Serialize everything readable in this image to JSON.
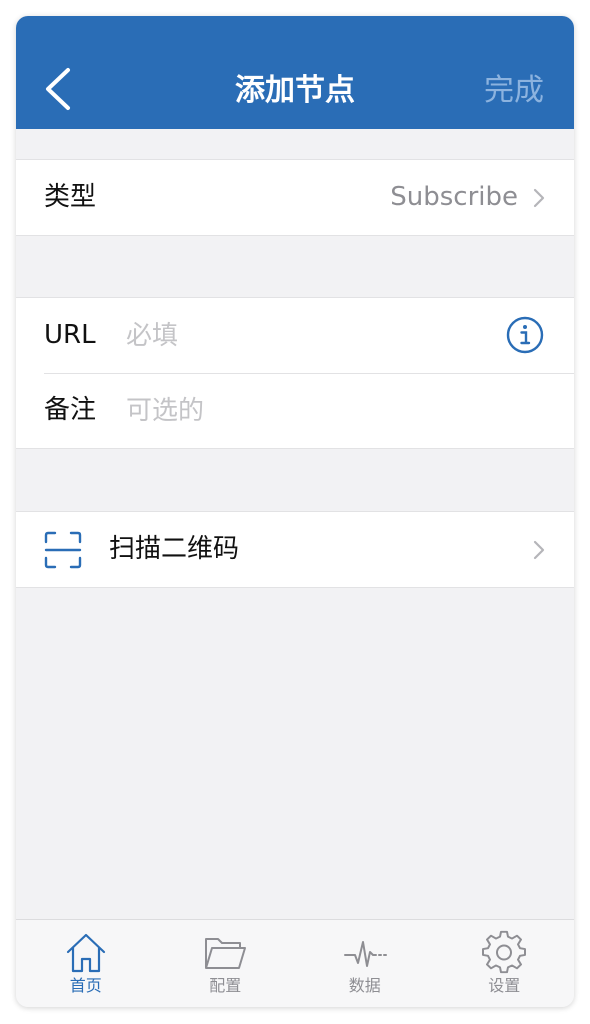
{
  "navbar": {
    "title": "添加节点",
    "done_label": "完成",
    "back_icon": "chevron-left-icon"
  },
  "type_row": {
    "label": "类型",
    "value": "Subscribe"
  },
  "url_row": {
    "label": "URL",
    "value": "",
    "placeholder": "必填",
    "icon": "info-icon"
  },
  "remark_row": {
    "label": "备注",
    "value": "",
    "placeholder": "可选的"
  },
  "scan_row": {
    "label": "扫描二维码",
    "icon": "qr-scan-icon"
  },
  "tabbar": {
    "active_index": 0,
    "tabs": [
      {
        "label": "首页",
        "icon": "home-icon"
      },
      {
        "label": "配置",
        "icon": "folder-icon"
      },
      {
        "label": "数据",
        "icon": "activity-icon"
      },
      {
        "label": "设置",
        "icon": "gear-icon"
      }
    ]
  },
  "colors": {
    "accent": "#2a6db6",
    "done_disabled": "#8cb3df",
    "background": "#f2f2f4",
    "placeholder": "#c4c4c7",
    "secondary_text": "#8e8e93"
  }
}
